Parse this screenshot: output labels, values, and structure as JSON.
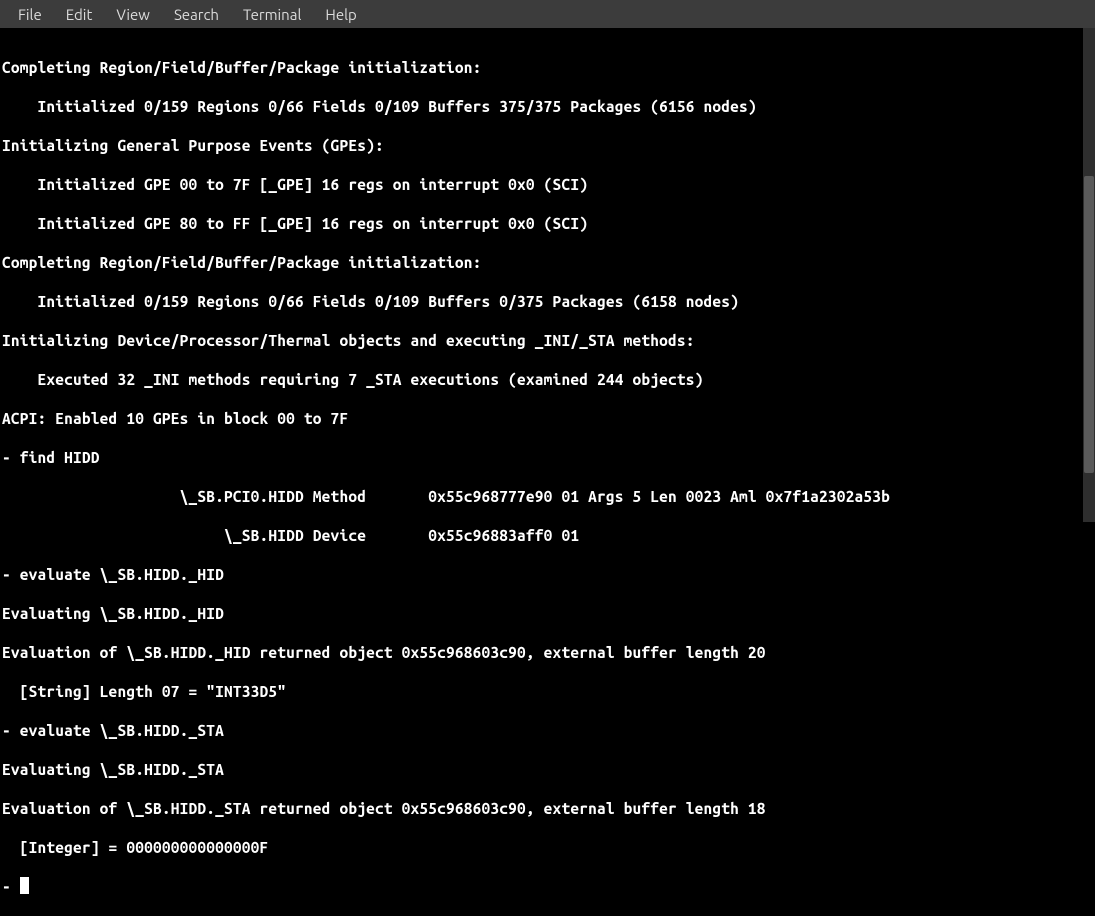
{
  "menubar": {
    "items": [
      "File",
      "Edit",
      "View",
      "Search",
      "Terminal",
      "Help"
    ]
  },
  "terminal": {
    "lines": [
      "Completing Region/Field/Buffer/Package initialization:",
      "    Initialized 0/159 Regions 0/66 Fields 0/109 Buffers 375/375 Packages (6156 nodes)",
      "Initializing General Purpose Events (GPEs):",
      "    Initialized GPE 00 to 7F [_GPE] 16 regs on interrupt 0x0 (SCI)",
      "    Initialized GPE 80 to FF [_GPE] 16 regs on interrupt 0x0 (SCI)",
      "Completing Region/Field/Buffer/Package initialization:",
      "    Initialized 0/159 Regions 0/66 Fields 0/109 Buffers 0/375 Packages (6158 nodes)",
      "Initializing Device/Processor/Thermal objects and executing _INI/_STA methods:",
      "    Executed 32 _INI methods requiring 7 _STA executions (examined 244 objects)",
      "ACPI: Enabled 10 GPEs in block 00 to 7F",
      "- find HIDD",
      "                    \\_SB.PCI0.HIDD Method       0x55c968777e90 01 Args 5 Len 0023 Aml 0x7f1a2302a53b",
      "                         \\_SB.HIDD Device       0x55c96883aff0 01",
      "- evaluate \\_SB.HIDD._HID",
      "Evaluating \\_SB.HIDD._HID",
      "Evaluation of \\_SB.HIDD._HID returned object 0x55c968603c90, external buffer length 20",
      "  [String] Length 07 = \"INT33D5\"",
      "- evaluate \\_SB.HIDD._STA",
      "Evaluating \\_SB.HIDD._STA",
      "Evaluation of \\_SB.HIDD._STA returned object 0x55c968603c90, external buffer length 18",
      "  [Integer] = 000000000000000F"
    ],
    "prompt": "- "
  }
}
